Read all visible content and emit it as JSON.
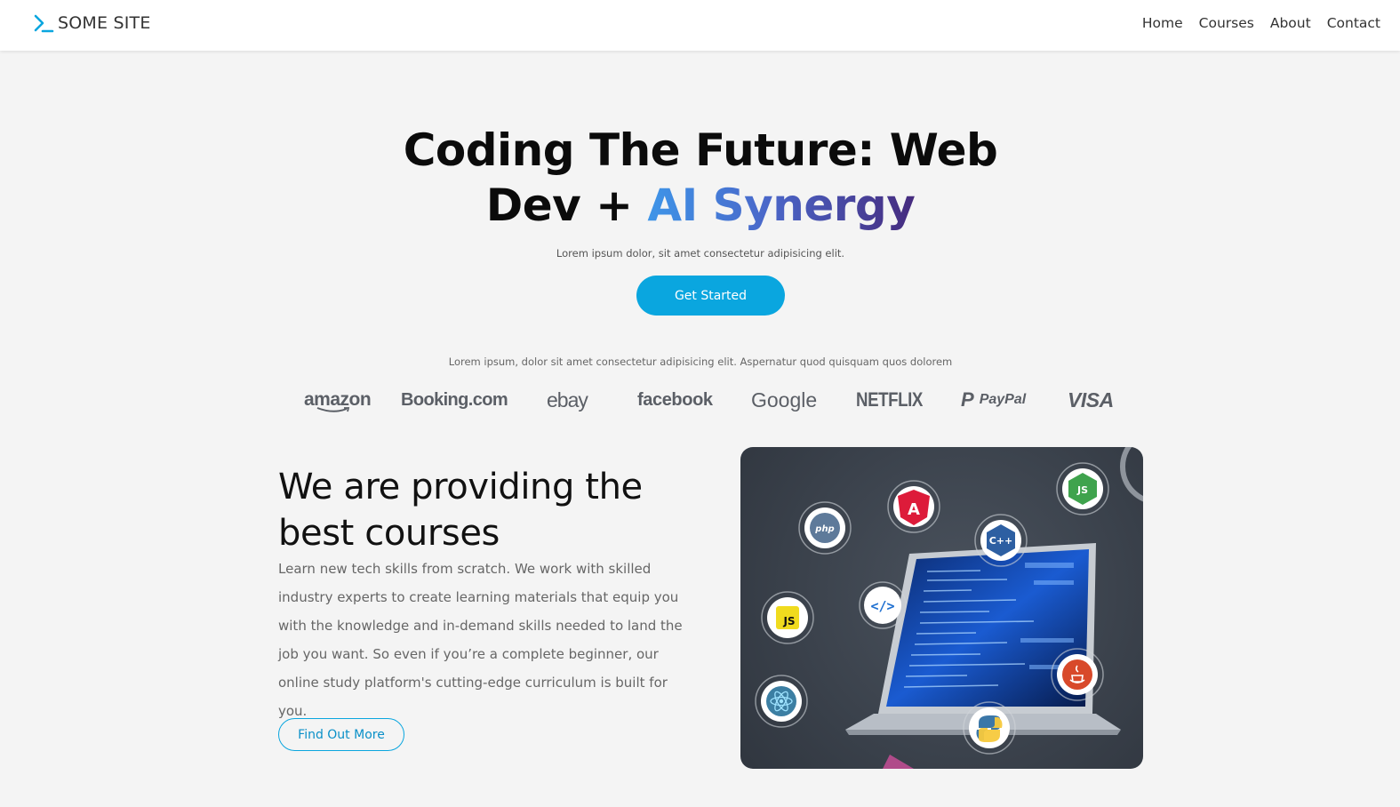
{
  "header": {
    "logo_text": "SOME SITE",
    "nav": [
      "Home",
      "Courses",
      "About",
      "Contact"
    ]
  },
  "hero": {
    "title_line1": "Coding The Future: Web",
    "title_line2_plain": "Dev + ",
    "title_line2_highlight": "AI Synergy",
    "subtitle": "Lorem ipsum dolor, sit amet consectetur adipisicing elit.",
    "cta_label": "Get Started"
  },
  "brands": {
    "caption": "Lorem ipsum, dolor sit amet consectetur adipisicing elit. Aspernatur quod quisquam quos dolorem",
    "items": [
      "amazon",
      "Booking.com",
      "ebay",
      "facebook",
      "Google",
      "NETFLIX",
      "PayPal",
      "VISA"
    ]
  },
  "feature": {
    "title": "We are providing the best courses",
    "body": "Learn new tech skills from scratch. We work with skilled industry experts to create learning materials that equip you with the knowledge and in-demand skills needed to land the job you want. So even if you’re a complete beginner, our online study platform's cutting-edge curriculum is built for you.",
    "button_label": "Find Out More"
  },
  "illustration": {
    "tech_badges": [
      "php",
      "A",
      "C++",
      "JS",
      "</>",
      "JS",
      "java",
      "python",
      "react"
    ]
  },
  "colors": {
    "accent": "#0aa6df",
    "gradient_start": "#3e95e8",
    "gradient_end": "#462b7e"
  }
}
